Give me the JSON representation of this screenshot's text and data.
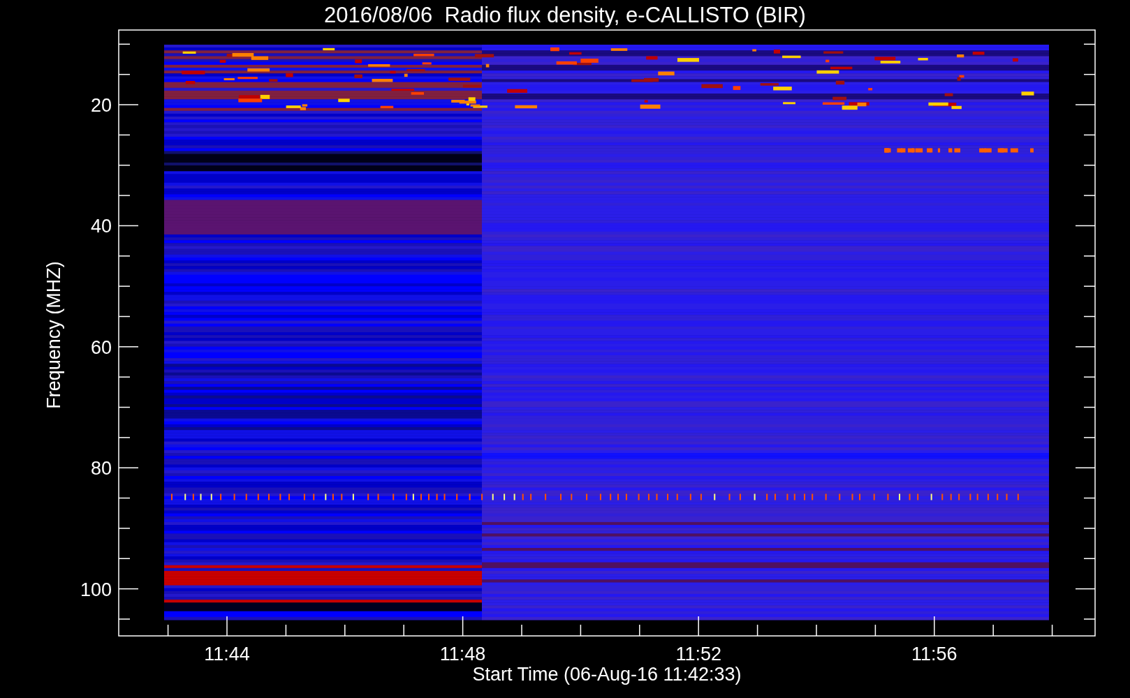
{
  "title": "2016/08/06  Radio flux density, e-CALLISTO (BIR)",
  "y_axis": {
    "label": "Frequency (MHZ)",
    "ticks": [
      "20",
      "40",
      "60",
      "80",
      "100"
    ]
  },
  "x_axis": {
    "label": "Start Time (06-Aug-16 11:42:33)",
    "ticks": [
      "11:44",
      "11:48",
      "11:52",
      "11:56"
    ]
  }
}
